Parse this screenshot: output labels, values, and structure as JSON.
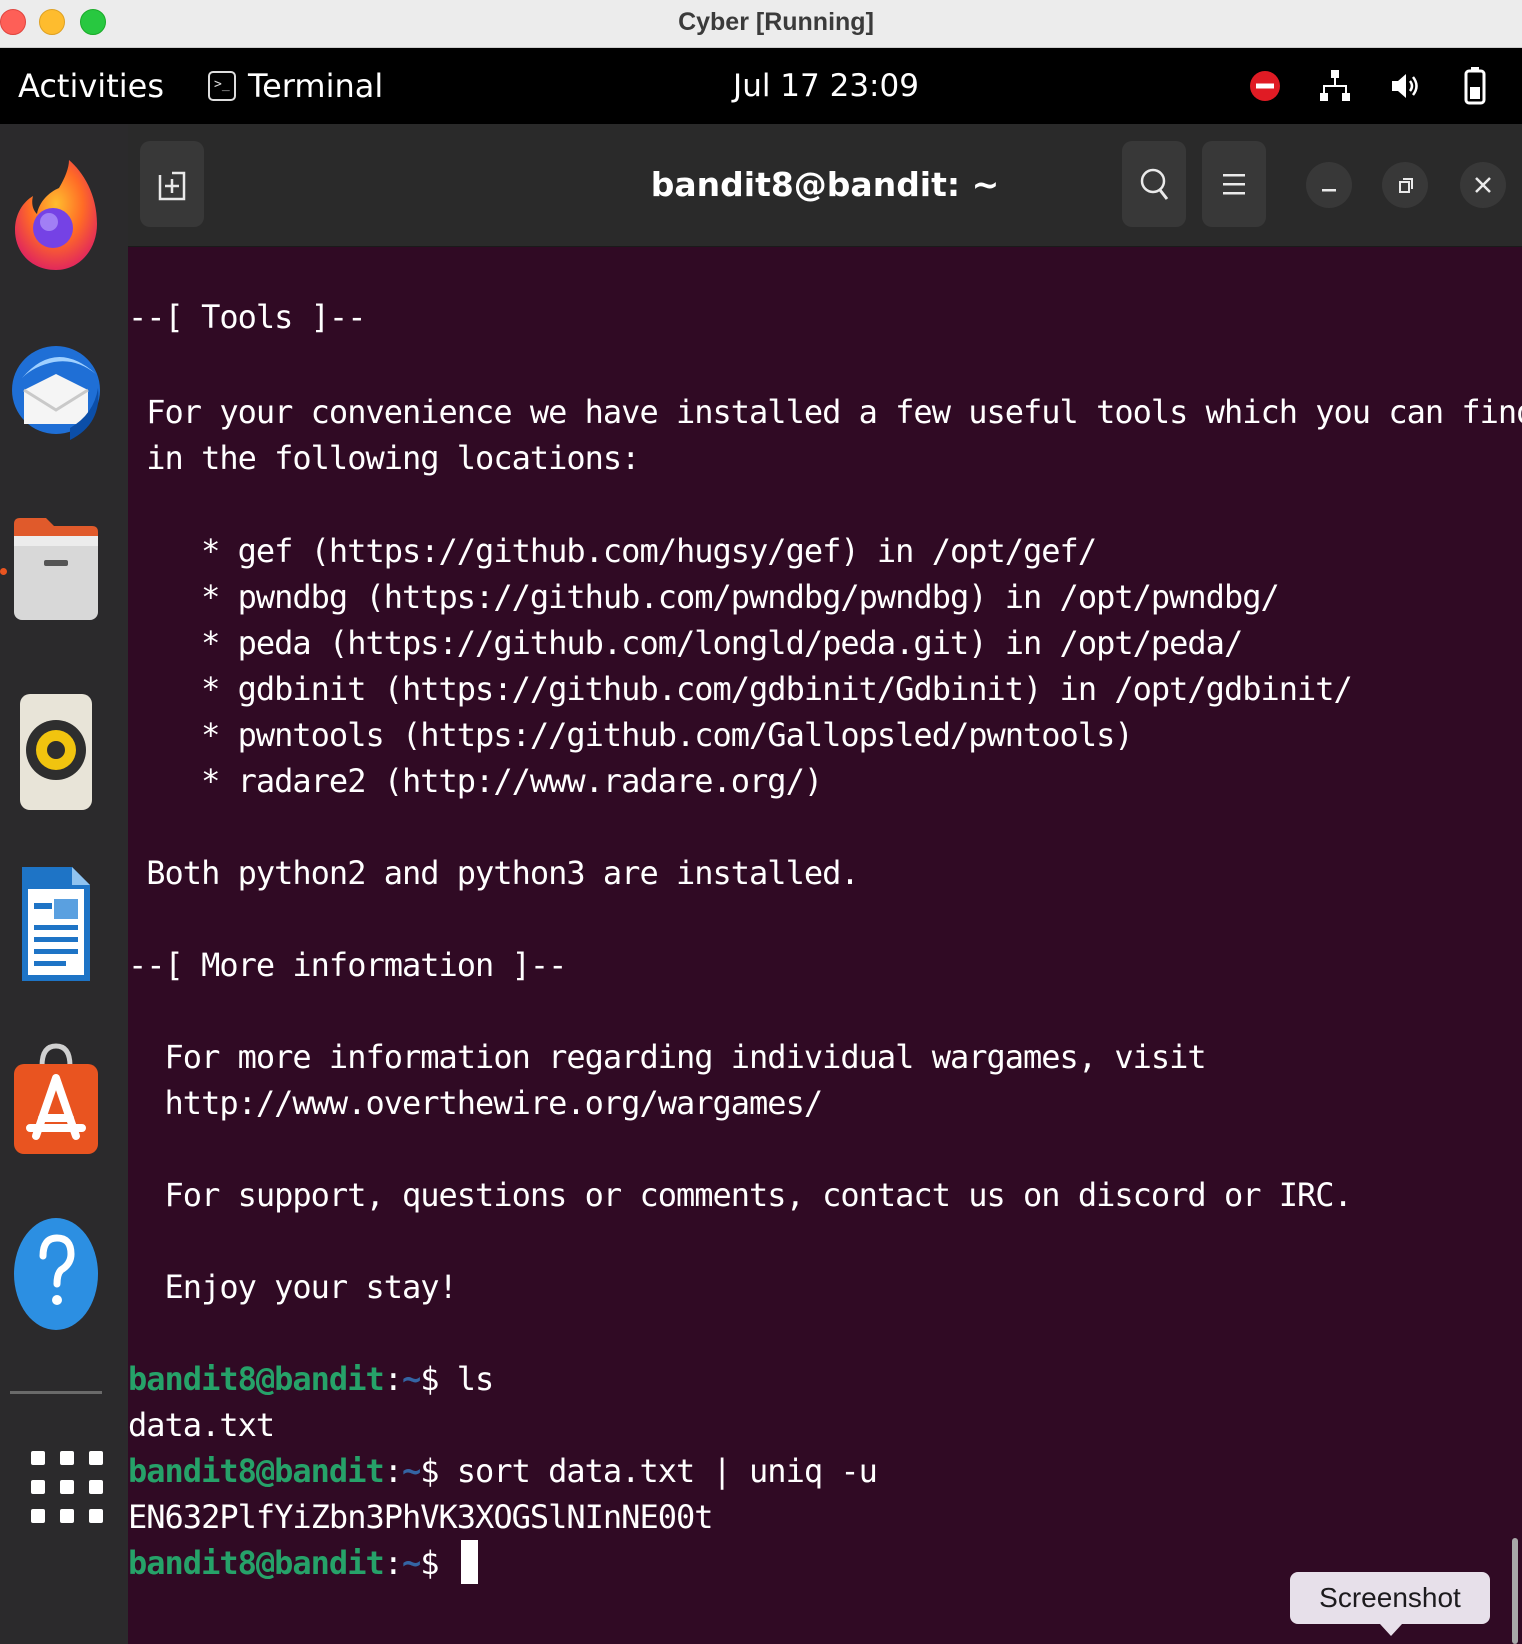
{
  "mac_window": {
    "title": "Cyber [Running]"
  },
  "topbar": {
    "activities": "Activities",
    "app_menu": "Terminal",
    "clock": "Jul 17  23:09",
    "tray_icons": [
      "do-not-disturb-icon",
      "network-icon",
      "volume-icon",
      "battery-icon"
    ]
  },
  "dock": {
    "apps": [
      "Firefox",
      "Thunderbird",
      "Files",
      "Rhythmbox",
      "LibreOffice Writer",
      "Ubuntu Software",
      "Help"
    ],
    "show_apps_icon": "app-grid-icon"
  },
  "terminal": {
    "title": "bandit8@bandit: ~",
    "colors": {
      "background": "#300a24",
      "user": "#26a269",
      "path": "#3465a4",
      "text": "#ffffff"
    },
    "lines": [
      "--[ Tools ]--",
      " For your convenience we have installed a few useful tools which you can find",
      " in the following locations:",
      "    * gef (https://github.com/hugsy/gef) in /opt/gef/",
      "    * pwndbg (https://github.com/pwndbg/pwndbg) in /opt/pwndbg/",
      "    * peda (https://github.com/longld/peda.git) in /opt/peda/",
      "    * gdbinit (https://github.com/gdbinit/Gdbinit) in /opt/gdbinit/",
      "    * pwntools (https://github.com/Gallopsled/pwntools)",
      "    * radare2 (http://www.radare.org/)",
      " Both python2 and python3 are installed.",
      "--[ More information ]--",
      "  For more information regarding individual wargames, visit",
      "  http://www.overthewire.org/wargames/",
      "  For support, questions or comments, contact us on discord or IRC.",
      "  Enjoy your stay!"
    ],
    "prompt_user": "bandit8@bandit",
    "prompt_sep": ":",
    "prompt_path": "~",
    "prompt_symbol": "$ ",
    "commands": [
      "ls",
      "sort data.txt | uniq -u"
    ],
    "outputs": [
      "data.txt",
      "EN632PlfYiZbn3PhVK3XOGSlNInNE00t"
    ]
  },
  "tooltip": {
    "label": "Screenshot"
  }
}
